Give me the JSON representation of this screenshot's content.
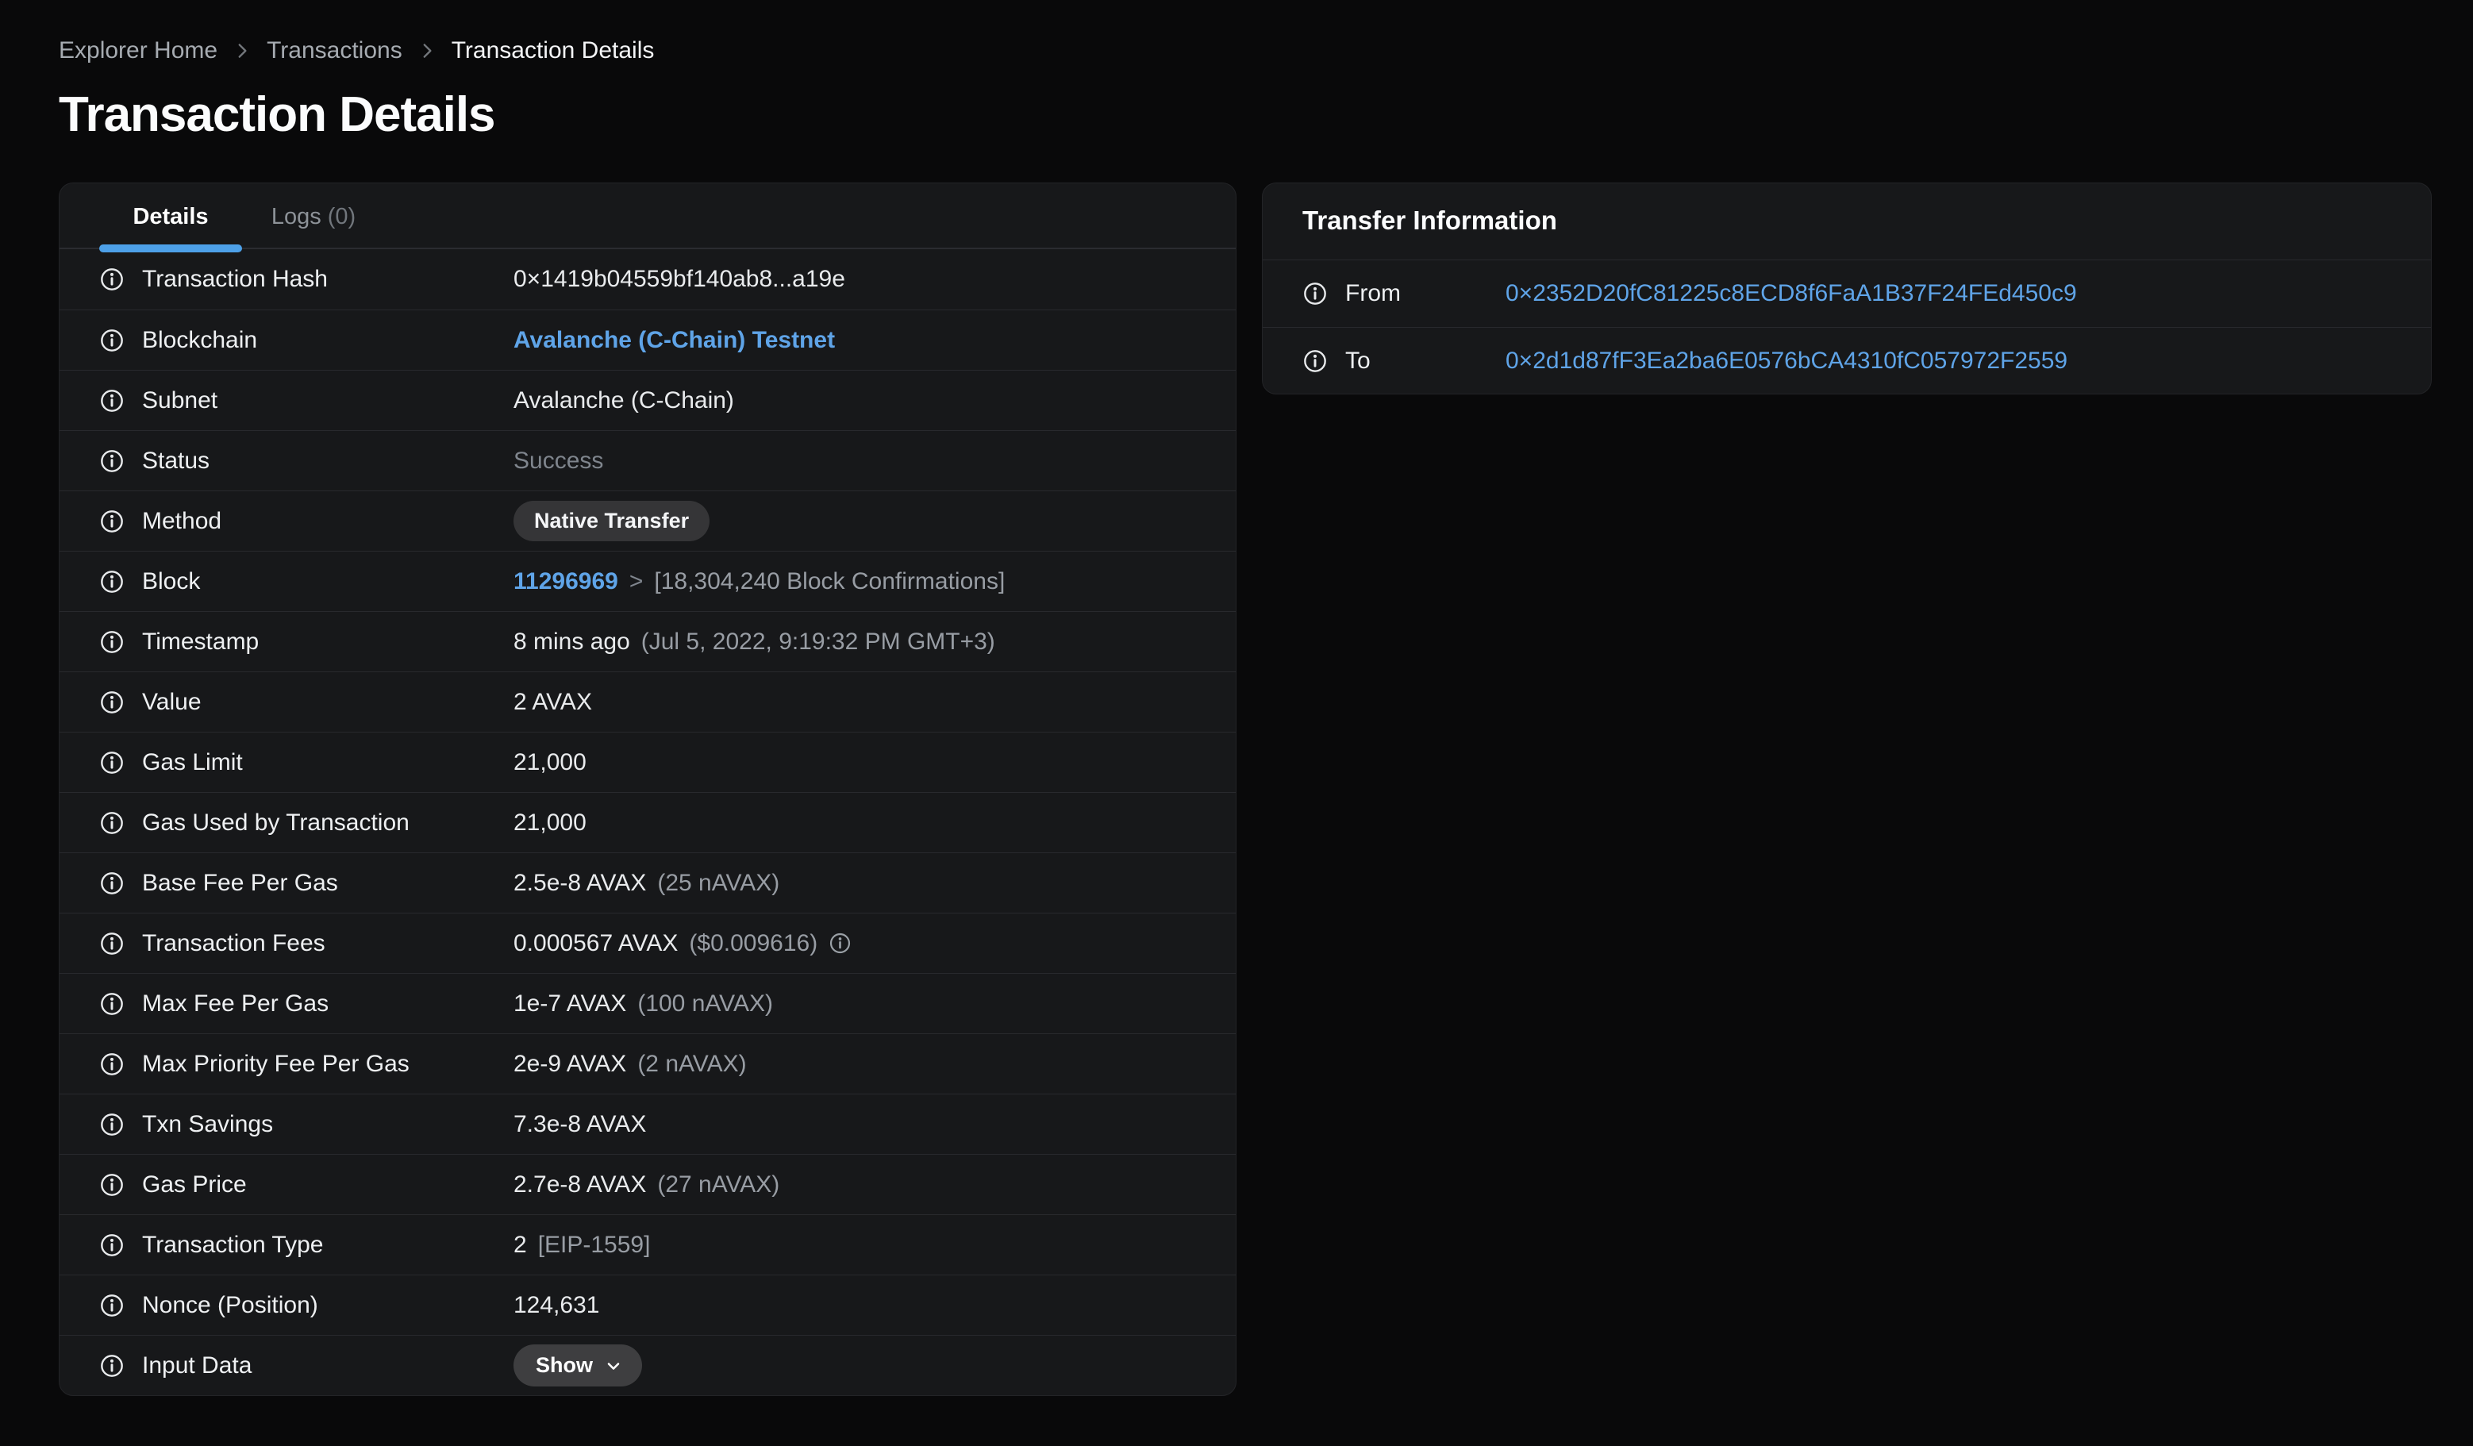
{
  "breadcrumb": {
    "items": [
      {
        "label": "Explorer Home",
        "current": false
      },
      {
        "label": "Transactions",
        "current": false
      },
      {
        "label": "Transaction Details",
        "current": true
      }
    ]
  },
  "page_title": "Transaction Details",
  "colors": {
    "accent_blue": "#5fa4e8",
    "tab_underline": "#4da0e8",
    "page_background": "#09090a",
    "card_background": "#17181a"
  },
  "details_card": {
    "tabs": [
      {
        "label": "Details",
        "count": "",
        "active": true
      },
      {
        "label": "Logs",
        "count": "(0)",
        "active": false
      }
    ],
    "rows": [
      {
        "label": "Transaction Hash",
        "value": [
          {
            "type": "text",
            "value": "0×1419b04559bf140ab8...a19e"
          }
        ]
      },
      {
        "label": "Blockchain",
        "value": [
          {
            "type": "link",
            "value": "Avalanche (C-Chain) Testnet"
          }
        ]
      },
      {
        "label": "Subnet",
        "value": [
          {
            "type": "text",
            "value": "Avalanche (C-Chain)"
          }
        ]
      },
      {
        "label": "Status",
        "value": [
          {
            "type": "dim",
            "value": "Success"
          }
        ]
      },
      {
        "label": "Method",
        "value": [
          {
            "type": "badge",
            "value": "Native Transfer"
          }
        ]
      },
      {
        "label": "Block",
        "value": [
          {
            "type": "link",
            "value": "11296969"
          },
          {
            "type": "dim",
            "value": ">"
          },
          {
            "type": "muted",
            "value": "[18,304,240 Block Confirmations]"
          }
        ]
      },
      {
        "label": "Timestamp",
        "value": [
          {
            "type": "text",
            "value": "8 mins ago"
          },
          {
            "type": "muted",
            "value": "(Jul 5, 2022, 9:19:32 PM GMT+3)"
          }
        ]
      },
      {
        "label": "Value",
        "value": [
          {
            "type": "text",
            "value": "2 AVAX"
          }
        ]
      },
      {
        "label": "Gas Limit",
        "value": [
          {
            "type": "text",
            "value": "21,000"
          }
        ]
      },
      {
        "label": "Gas Used by Transaction",
        "value": [
          {
            "type": "text",
            "value": "21,000"
          }
        ]
      },
      {
        "label": "Base Fee Per Gas",
        "value": [
          {
            "type": "text",
            "value": "2.5e-8 AVAX"
          },
          {
            "type": "muted",
            "value": "(25 nAVAX)"
          }
        ]
      },
      {
        "label": "Transaction Fees",
        "value": [
          {
            "type": "text",
            "value": "0.000567 AVAX"
          },
          {
            "type": "muted",
            "value": "($0.009616)"
          },
          {
            "type": "info",
            "value": ""
          }
        ]
      },
      {
        "label": "Max Fee Per Gas",
        "value": [
          {
            "type": "text",
            "value": "1e-7 AVAX"
          },
          {
            "type": "muted",
            "value": "(100 nAVAX)"
          }
        ]
      },
      {
        "label": "Max Priority Fee Per Gas",
        "value": [
          {
            "type": "text",
            "value": "2e-9 AVAX"
          },
          {
            "type": "muted",
            "value": "(2 nAVAX)"
          }
        ]
      },
      {
        "label": "Txn Savings",
        "value": [
          {
            "type": "text",
            "value": "7.3e-8 AVAX"
          }
        ]
      },
      {
        "label": "Gas Price",
        "value": [
          {
            "type": "text",
            "value": "2.7e-8 AVAX"
          },
          {
            "type": "muted",
            "value": "(27 nAVAX)"
          }
        ]
      },
      {
        "label": "Transaction Type",
        "value": [
          {
            "type": "text",
            "value": "2"
          },
          {
            "type": "muted",
            "value": "[EIP-1559]"
          }
        ]
      },
      {
        "label": "Nonce (Position)",
        "value": [
          {
            "type": "text",
            "value": "124,631"
          }
        ]
      },
      {
        "label": "Input Data",
        "value": [
          {
            "type": "button",
            "value": "Show"
          }
        ]
      }
    ]
  },
  "transfer_card": {
    "title": "Transfer Information",
    "rows": [
      {
        "label": "From",
        "address": "0×2352D20fC81225c8ECD8f6FaA1B37F24FEd450c9"
      },
      {
        "label": "To",
        "address": "0×2d1d87fF3Ea2ba6E0576bCA4310fC057972F2559"
      }
    ]
  }
}
